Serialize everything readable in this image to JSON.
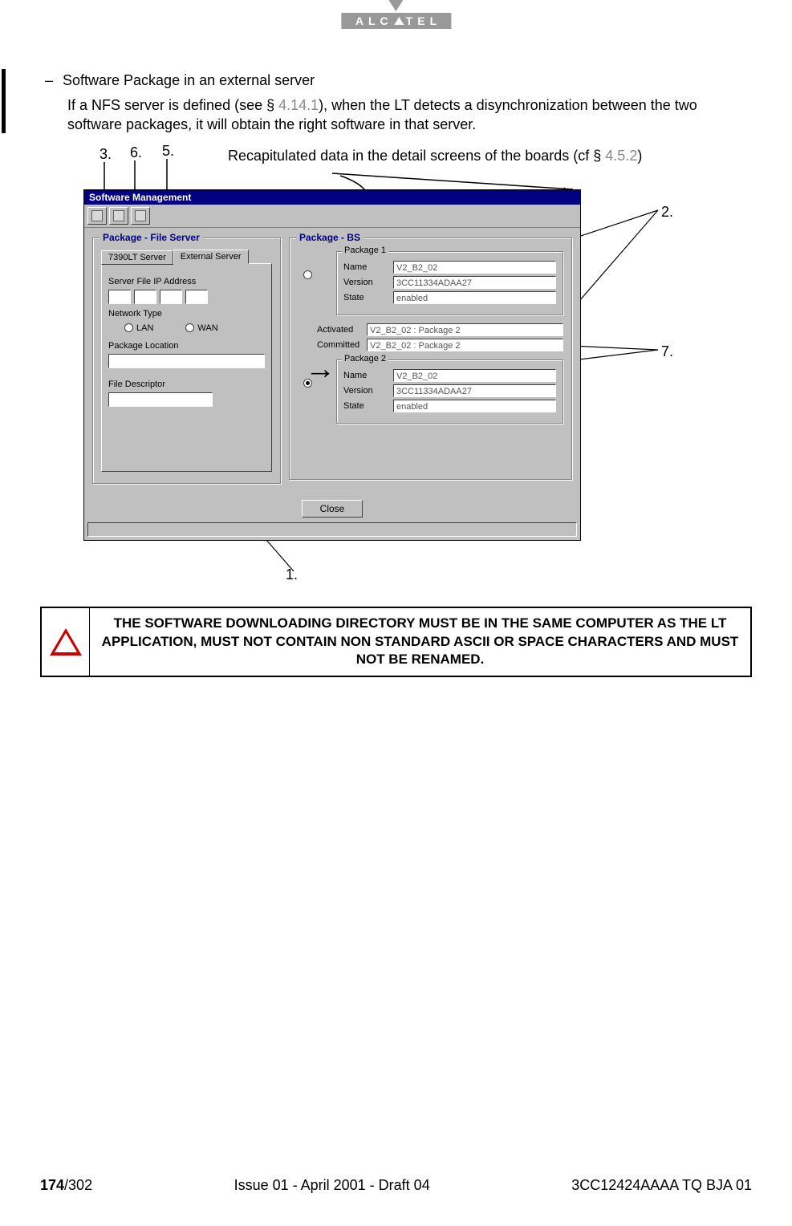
{
  "brand": {
    "name": "ALCATEL"
  },
  "body": {
    "bullet": "Software Package in an external server",
    "para_pre": "If a NFS server is defined  (see § ",
    "para_ref1": "4.14.1",
    "para_post": "), when the LT detects a disynchronization between the two software packages, it will obtain the right software in that server."
  },
  "callouts": {
    "c1": "1.",
    "c2": "2.",
    "c3": "3.",
    "c5": "5.",
    "c6": "6.",
    "c7": "7."
  },
  "caption_pre": "Recapitulated data in the detail screens of the boards (cf § ",
  "caption_ref": "4.5.2",
  "caption_post": ")",
  "dialog": {
    "title": "Software Management",
    "left_group": "Package - File Server",
    "tabs": {
      "t1": "7390LT Server",
      "t2": "External Server"
    },
    "labels": {
      "ip": "Server File IP Address",
      "net": "Network Type",
      "lan": "LAN",
      "wan": "WAN",
      "loc": "Package Location",
      "desc": "File Descriptor"
    },
    "right_group": "Package - BS",
    "pkg1_title": "Package 1",
    "pkg2_title": "Package 2",
    "fields": {
      "name": "Name",
      "version": "Version",
      "state": "State",
      "activated": "Activated",
      "committed": "Committed"
    },
    "pkg1": {
      "name": "V2_B2_02",
      "version": "3CC11334ADAA27",
      "state": "enabled"
    },
    "pkg2": {
      "name": "V2_B2_02",
      "version": "3CC11334ADAA27",
      "state": "enabled"
    },
    "activated_val": "V2_B2_02 : Package 2",
    "committed_val": "V2_B2_02 : Package 2",
    "close": "Close"
  },
  "warning": "THE SOFTWARE DOWNLOADING DIRECTORY MUST BE IN THE SAME COMPUTER AS THE LT APPLICATION, MUST NOT CONTAIN NON STANDARD ASCII OR SPACE CHARACTERS AND MUST NOT BE RENAMED.",
  "footer": {
    "page_bold": "174",
    "page_total": "/302",
    "center": "Issue 01 - April 2001 - Draft 04",
    "right": "3CC12424AAAA TQ BJA 01"
  }
}
